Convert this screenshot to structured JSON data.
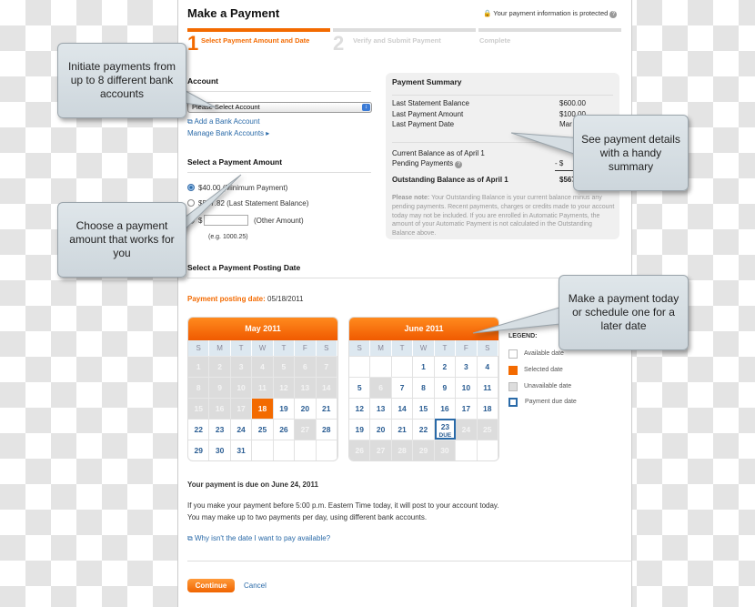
{
  "header": {
    "title": "Make a Payment",
    "protected_text": "Your payment information is protected"
  },
  "steps": [
    {
      "num": "1",
      "label": "Select Payment Amount and Date",
      "active": true
    },
    {
      "num": "2",
      "label": "Verify and Submit Payment",
      "active": false
    },
    {
      "num": "",
      "label": "Complete",
      "active": false
    }
  ],
  "account": {
    "heading": "Account",
    "select_value": "Please Select Account",
    "add_link": "Add a Bank Account",
    "manage_link": "Manage Bank Accounts ▸"
  },
  "amount": {
    "heading": "Select a Payment Amount",
    "options": [
      {
        "label": "$40.00 (Minimum Payment)",
        "checked": true
      },
      {
        "label": "$567.82 (Last Statement Balance)",
        "checked": false
      }
    ],
    "other_prefix": "$",
    "other_value": "",
    "other_label": "(Other Amount)",
    "example": "(e.g. 1000.25)"
  },
  "summary": {
    "title": "Payment Summary",
    "rows": [
      {
        "label": "Last Statement Balance",
        "value": "$600.00"
      },
      {
        "label": "Last Payment Amount",
        "value": "$100.00"
      },
      {
        "label": "Last Payment Date",
        "value": "Mar"
      }
    ],
    "current_label": "Current Balance as of April 1",
    "pending_label": "Pending Payments",
    "pending_value": "- $",
    "outstanding_label": "Outstanding Balance as of April 1",
    "outstanding_value": "$567",
    "note_bold": "Please note:",
    "note": " Your Outstanding Balance is your current balance minus any pending payments. Recent payments, charges or credits made to your account today may not be included. If you are enrolled in Automatic Payments, the amount of your Automatic Payment is not calculated in the Outstanding Balance above."
  },
  "posting": {
    "heading": "Select a Payment Posting Date",
    "date_label": "Payment posting date:",
    "date_value": "05/18/2011"
  },
  "calendar": {
    "dow": [
      "S",
      "M",
      "T",
      "W",
      "T",
      "F",
      "S"
    ],
    "months": [
      {
        "title": "May 2011",
        "first_weekday": 0,
        "days": 31,
        "unavailable": [
          1,
          2,
          3,
          4,
          5,
          6,
          7,
          8,
          9,
          10,
          11,
          12,
          13,
          14,
          15,
          16,
          17,
          27
        ],
        "selected": 18,
        "due": null
      },
      {
        "title": "June 2011",
        "first_weekday": 3,
        "days": 30,
        "unavailable": [
          6,
          24,
          25,
          26,
          27,
          28,
          29,
          30
        ],
        "selected": null,
        "due": 23
      }
    ],
    "due_label": "DUE"
  },
  "legend": {
    "title": "LEGEND:",
    "items": [
      "Available date",
      "Selected date",
      "Unavailable date",
      "Payment due date"
    ]
  },
  "footer": {
    "due_text": "Your payment is due on June 24, 2011",
    "line1": "If you make your payment before 5:00 p.m. Eastern Time today, it will post to your account today.",
    "line2": "You may make up to two payments per day, using different bank accounts.",
    "why_link": "Why isn't the date I want to pay available?",
    "continue": "Continue",
    "cancel": "Cancel"
  },
  "callouts": [
    "Initiate payments from up to 8 different bank accounts",
    "See payment details with a handy summary",
    "Choose a payment amount that works for you",
    "Make a payment today or schedule one for a later date"
  ],
  "colors": {
    "accent": "#f36a00",
    "link": "#2a6aa8"
  }
}
